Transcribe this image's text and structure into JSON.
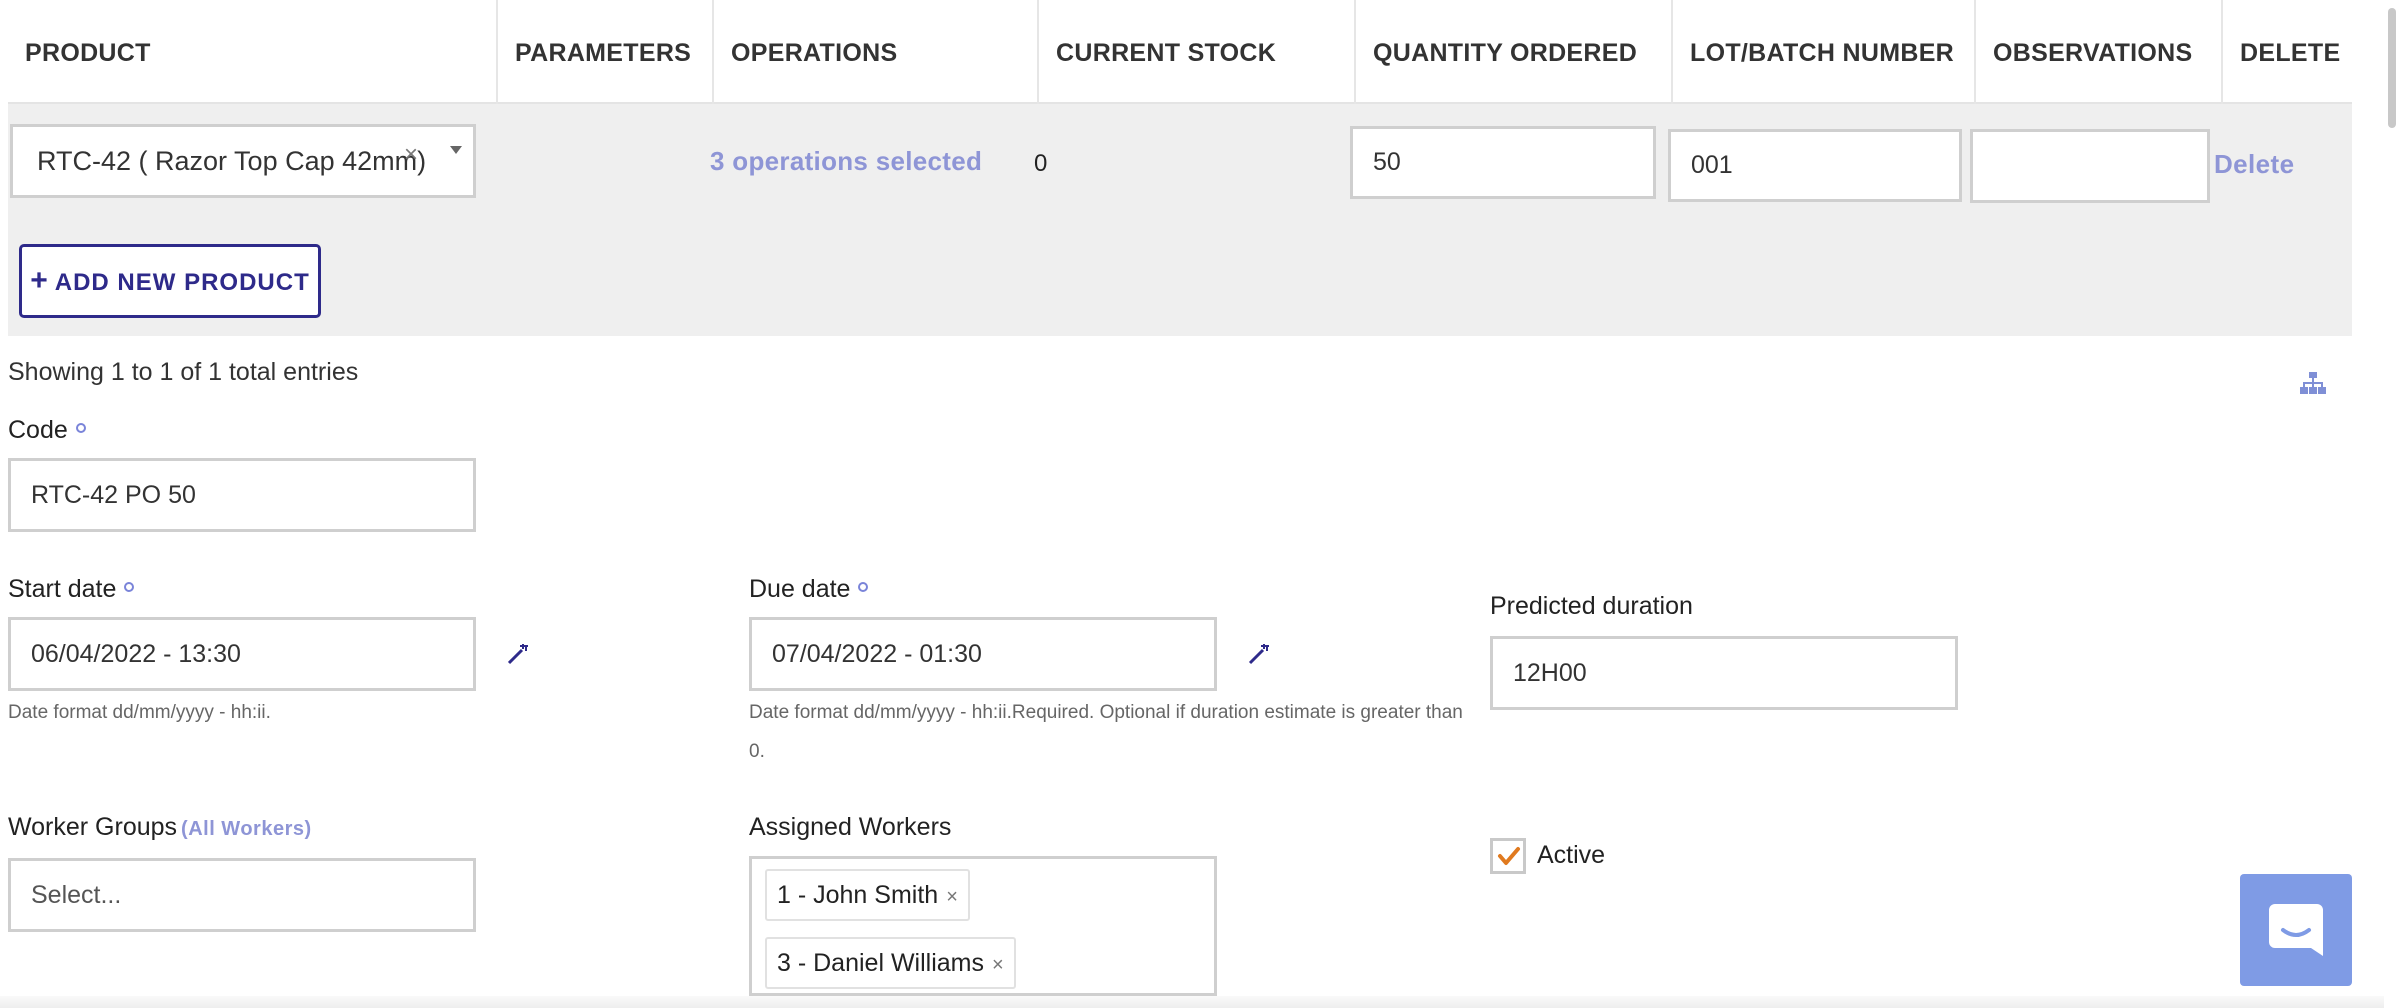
{
  "table": {
    "headers": {
      "product": "PRODUCT",
      "parameters": "PARAMETERS",
      "operations": "OPERATIONS",
      "current_stock": "CURRENT STOCK",
      "quantity_ordered": "QUANTITY ORDERED",
      "lot_batch_number": "LOT/BATCH NUMBER",
      "observations": "OBSERVATIONS",
      "delete": "DELETE"
    },
    "rows": [
      {
        "product": "RTC-42 ( Razor Top Cap 42mm)",
        "operations": "3 operations selected",
        "current_stock": "0",
        "quantity_ordered": "50",
        "lot_batch_number": "001",
        "observations": "",
        "delete": "Delete"
      }
    ],
    "add_button": "ADD NEW PRODUCT",
    "showing": "Showing 1 to 1 of 1 total entries"
  },
  "form": {
    "code": {
      "label": "Code",
      "value": "RTC-42 PO 50"
    },
    "start_date": {
      "label": "Start date",
      "value": "06/04/2022 - 13:30",
      "hint": "Date format dd/mm/yyyy - hh:ii."
    },
    "due_date": {
      "label": "Due date",
      "value": "07/04/2022 - 01:30",
      "hint_line1": "Date format dd/mm/yyyy - hh:ii.Required. Optional if duration estimate is greater than",
      "hint_line2": "0."
    },
    "predicted_duration": {
      "label": "Predicted duration",
      "value": "12H00"
    },
    "worker_groups": {
      "label": "Worker Groups",
      "link": "(All Workers)",
      "placeholder": "Select..."
    },
    "assigned_workers": {
      "label": "Assigned Workers",
      "tags": [
        "1 - John Smith",
        "3 - Daniel Williams"
      ]
    },
    "active": {
      "label": "Active",
      "checked": true
    }
  },
  "colors": {
    "link": "#8e95d6",
    "primary": "#2e2a8a",
    "check": "#e07a1f",
    "chat": "#7f9be5"
  },
  "icons": {
    "tree": "sitemap-icon",
    "wand": "magic-wand-icon",
    "chat": "chat-icon"
  }
}
